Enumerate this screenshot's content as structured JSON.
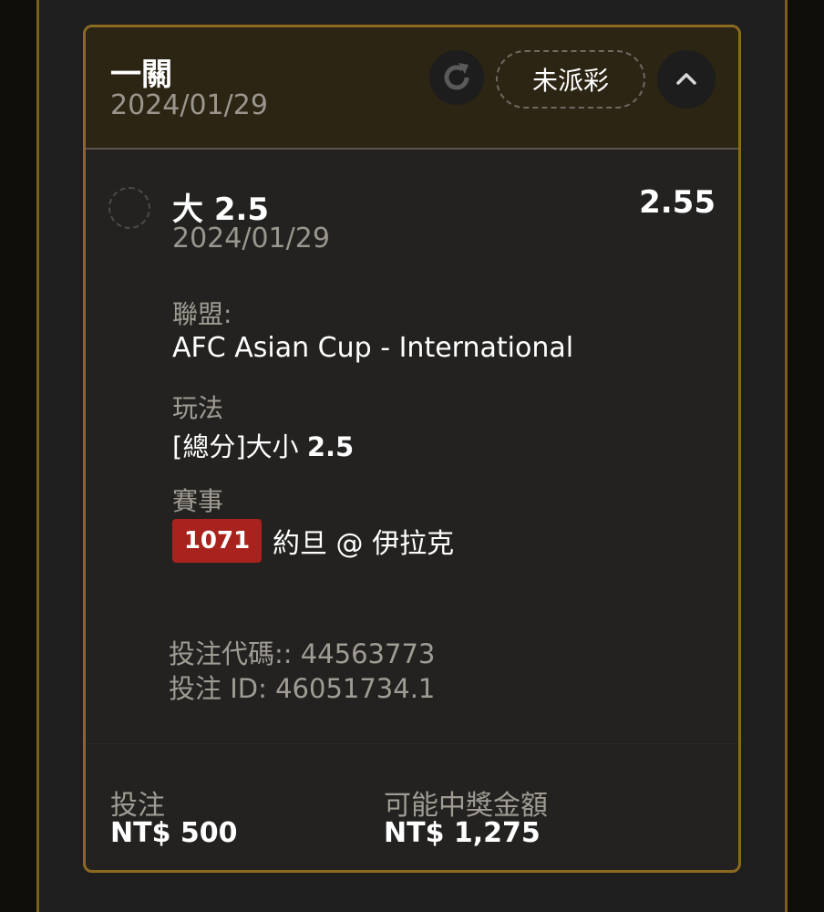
{
  "header": {
    "title": "一關",
    "date": "2024/01/29",
    "status_label": "未派彩",
    "refresh_icon": "refresh-icon",
    "collapse_icon": "chevron-up-icon"
  },
  "selection": {
    "title_prefix": "大",
    "title_line": "2.5",
    "odds": "2.55",
    "date": "2024/01/29",
    "league_label": "聯盟:",
    "league_value": "AFC Asian Cup - International",
    "bet_type_label": "玩法",
    "bet_type_value_prefix": "[總分]大小",
    "bet_type_value_line": "2.5",
    "event_label": "賽事",
    "event_code": "1071",
    "event_name": "約旦 @ 伊拉克"
  },
  "codes": {
    "bet_code": "投注代碼:: 44563773",
    "bet_id": "投注 ID: 46051734.1"
  },
  "footer": {
    "stake_label": "投注",
    "stake_value": "NT$ 500",
    "payout_label": "可能中獎金額",
    "payout_value": "NT$ 1,275"
  },
  "colors": {
    "accent_gold": "#8b6a1f",
    "header_bg": "#2c2514",
    "badge_red": "#a8231d"
  }
}
